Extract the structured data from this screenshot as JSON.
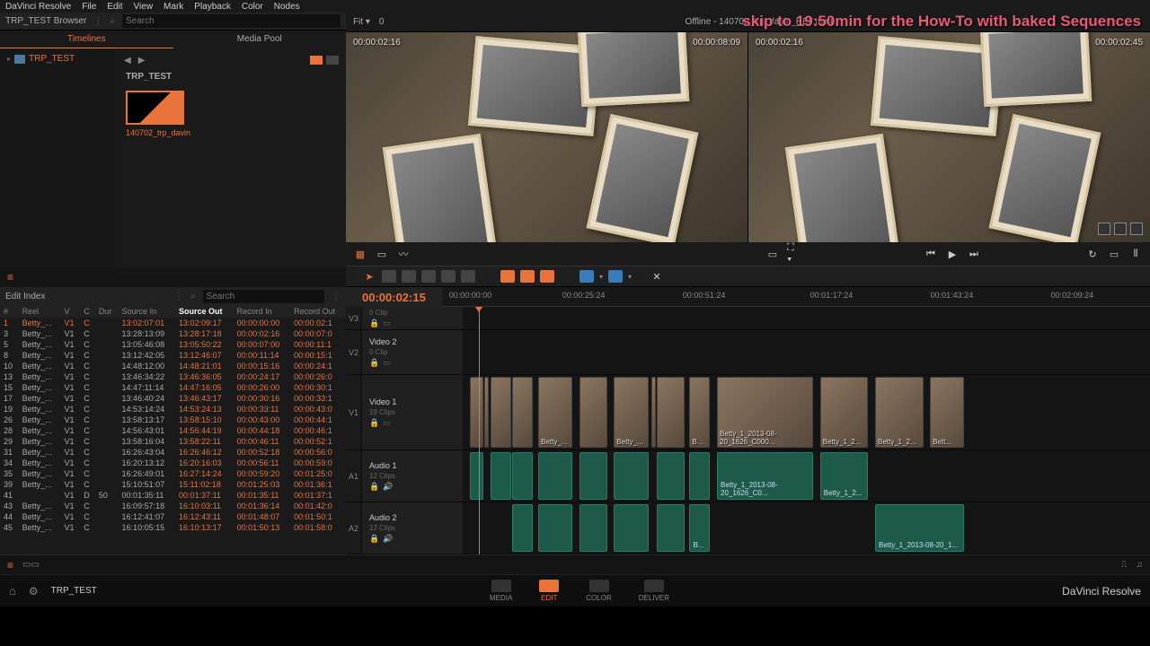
{
  "overlay_text": "skip to 19:50min for the How-To with baked Sequences",
  "menubar": [
    "DaVinci Resolve",
    "File",
    "Edit",
    "View",
    "Mark",
    "Playback",
    "Color",
    "Nodes"
  ],
  "browser": {
    "title": "TRP_TEST Browser",
    "search_ph": "Search",
    "tabs": {
      "timelines": "Timelines",
      "mediapool": "Media Pool"
    },
    "tree_item": "TRP_TEST",
    "bin_title": "TRP_TEST",
    "thumb_label": "140702_trp_davin"
  },
  "viewer": {
    "fit": "Fit",
    "zoom": "0",
    "title": "Offline - 140702_trp_davin_REF.mp4",
    "tc_left_src": "00:00:02:16",
    "tc_right_src": "00:00:08:09",
    "tc_left_rec": "00:00:02:16",
    "tc_right_rec": "00:00:02:45"
  },
  "toolbar_labels": {
    "arrow": "select",
    "razor": "blade"
  },
  "editindex": {
    "title": "Edit Index",
    "search_ph": "Search",
    "cols": [
      "#",
      "Reel",
      "V",
      "C",
      "Dur",
      "Source In",
      "Source Out",
      "Record In",
      "Record Out"
    ],
    "rows": [
      {
        "n": "1",
        "reel": "Betty_...",
        "v": "V1",
        "c": "C",
        "dur": "",
        "si": "13:02:07:01",
        "so": "13:02:09:17",
        "ri": "00:00:00:00",
        "ro": "00:00:02:1",
        "sel": true
      },
      {
        "n": "3",
        "reel": "Betty_...",
        "v": "V1",
        "c": "C",
        "dur": "",
        "si": "13:28:13:09",
        "so": "13:28:17:18",
        "ri": "00:00:02:16",
        "ro": "00:00:07:0"
      },
      {
        "n": "5",
        "reel": "Betty_...",
        "v": "V1",
        "c": "C",
        "dur": "",
        "si": "13:05:46:08",
        "so": "13:05:50:22",
        "ri": "00:00:07:00",
        "ro": "00:00:11:1"
      },
      {
        "n": "8",
        "reel": "Betty_...",
        "v": "V1",
        "c": "C",
        "dur": "",
        "si": "13:12:42:05",
        "so": "13:12:46:07",
        "ri": "00:00:11:14",
        "ro": "00:00:15:1"
      },
      {
        "n": "10",
        "reel": "Betty_...",
        "v": "V1",
        "c": "C",
        "dur": "",
        "si": "14:48:12:00",
        "so": "14:48:21:01",
        "ri": "00:00:15:16",
        "ro": "00:00:24:1"
      },
      {
        "n": "13",
        "reel": "Betty_...",
        "v": "V1",
        "c": "C",
        "dur": "",
        "si": "13:46:34:22",
        "so": "13:46:36:05",
        "ri": "00:00:24:17",
        "ro": "00:00:26:0"
      },
      {
        "n": "15",
        "reel": "Betty_...",
        "v": "V1",
        "c": "C",
        "dur": "",
        "si": "14:47:11:14",
        "so": "14:47:16:05",
        "ri": "00:00:26:00",
        "ro": "00:00:30:1"
      },
      {
        "n": "17",
        "reel": "Betty_...",
        "v": "V1",
        "c": "C",
        "dur": "",
        "si": "13:46:40:24",
        "so": "13:46:43:17",
        "ri": "00:00:30:16",
        "ro": "00:00:33:1"
      },
      {
        "n": "19",
        "reel": "Betty_...",
        "v": "V1",
        "c": "C",
        "dur": "",
        "si": "14:53:14:24",
        "so": "14:53:24:13",
        "ri": "00:00:33:11",
        "ro": "00:00:43:0"
      },
      {
        "n": "26",
        "reel": "Betty_...",
        "v": "V1",
        "c": "C",
        "dur": "",
        "si": "13:58:13:17",
        "so": "13:58:15:10",
        "ri": "00:00:43:00",
        "ro": "00:00:44:1"
      },
      {
        "n": "28",
        "reel": "Betty_...",
        "v": "V1",
        "c": "C",
        "dur": "",
        "si": "14:56:43:01",
        "so": "14:56:44:19",
        "ri": "00:00:44:18",
        "ro": "00:00:46:1"
      },
      {
        "n": "29",
        "reel": "Betty_...",
        "v": "V1",
        "c": "C",
        "dur": "",
        "si": "13:58:16:04",
        "so": "13:58:22:11",
        "ri": "00:00:46:11",
        "ro": "00:00:52:1"
      },
      {
        "n": "31",
        "reel": "Betty_...",
        "v": "V1",
        "c": "C",
        "dur": "",
        "si": "16:26:43:04",
        "so": "16:26:46:12",
        "ri": "00:00:52:18",
        "ro": "00:00:56:0"
      },
      {
        "n": "34",
        "reel": "Betty_...",
        "v": "V1",
        "c": "C",
        "dur": "",
        "si": "16:20:13:12",
        "so": "16:20:16:03",
        "ri": "00:00:56:11",
        "ro": "00:00:59:0"
      },
      {
        "n": "35",
        "reel": "Betty_...",
        "v": "V1",
        "c": "C",
        "dur": "",
        "si": "16:26:49:01",
        "so": "16:27:14:24",
        "ri": "00:00:59:20",
        "ro": "00:01:25:0"
      },
      {
        "n": "39",
        "reel": "Betty_...",
        "v": "V1",
        "c": "C",
        "dur": "",
        "si": "15:10:51:07",
        "so": "15:11:02:18",
        "ri": "00:01:25:03",
        "ro": "00:01:36:1"
      },
      {
        "n": "41",
        "reel": "",
        "v": "V1",
        "c": "D",
        "dur": "50",
        "si": "00:01:35:11",
        "so": "00:01:37:11",
        "ri": "00:01:35:11",
        "ro": "00:01:37:1"
      },
      {
        "n": "43",
        "reel": "Betty_...",
        "v": "V1",
        "c": "C",
        "dur": "",
        "si": "16:09:57:18",
        "so": "16:10:03:11",
        "ri": "00:01:36:14",
        "ro": "00:01:42:0"
      },
      {
        "n": "44",
        "reel": "Betty_...",
        "v": "V1",
        "c": "C",
        "dur": "",
        "si": "16:12:41:07",
        "so": "16:12:43:11",
        "ri": "00:01:48:07",
        "ro": "00:01:50:1"
      },
      {
        "n": "45",
        "reel": "Betty_...",
        "v": "V1",
        "c": "C",
        "dur": "",
        "si": "16:10:05:15",
        "so": "16:10:13:17",
        "ri": "00:01:50:13",
        "ro": "00:01:58:0"
      }
    ]
  },
  "timeline": {
    "tc": "00:00:02:15",
    "ruler": [
      {
        "t": "00:00:00:00",
        "p": 1
      },
      {
        "t": "00:00:25:24",
        "p": 17
      },
      {
        "t": "00:00:51:24",
        "p": 34
      },
      {
        "t": "00:01:17:24",
        "p": 52
      },
      {
        "t": "00:01:43:24",
        "p": 69
      },
      {
        "t": "00:02:09:24",
        "p": 86
      }
    ],
    "playhead_pct": 2,
    "tracks": {
      "v3": {
        "lbl": "V3",
        "sub": "0 Clip"
      },
      "v2": {
        "name": "Video 2",
        "lbl": "V2",
        "sub": "0 Clip"
      },
      "v1": {
        "name": "Video 1",
        "lbl": "V1",
        "sub": "19 Clips",
        "clips": [
          {
            "l": 1,
            "w": 2,
            "t": ""
          },
          {
            "l": 3.2,
            "w": 0.6,
            "t": ""
          },
          {
            "l": 4,
            "w": 3,
            "t": ""
          },
          {
            "l": 7.2,
            "w": 3,
            "t": ""
          },
          {
            "l": 11,
            "w": 5,
            "t": "Betty_..."
          },
          {
            "l": 17,
            "w": 4,
            "t": ""
          },
          {
            "l": 22,
            "w": 5,
            "t": "Betty_..."
          },
          {
            "l": 27.5,
            "w": 0.6,
            "t": ""
          },
          {
            "l": 28.3,
            "w": 4,
            "t": ""
          },
          {
            "l": 33,
            "w": 3,
            "t": "B..."
          },
          {
            "l": 37,
            "w": 14,
            "t": "Betty_1_2013-08-20_1626_C000..."
          },
          {
            "l": 52,
            "w": 7,
            "t": "Betty_1_2..."
          },
          {
            "l": 60,
            "w": 7,
            "t": "Betty_1_2..."
          },
          {
            "l": 68,
            "w": 5,
            "t": "Bett..."
          }
        ]
      },
      "a1": {
        "name": "Audio 1",
        "lbl": "A1",
        "sub": "12 Clips",
        "clips": [
          {
            "l": 1,
            "w": 2,
            "t": ""
          },
          {
            "l": 4,
            "w": 3,
            "t": ""
          },
          {
            "l": 7.2,
            "w": 3,
            "t": ""
          },
          {
            "l": 11,
            "w": 5,
            "t": ""
          },
          {
            "l": 17,
            "w": 4,
            "t": ""
          },
          {
            "l": 22,
            "w": 5,
            "t": ""
          },
          {
            "l": 28.3,
            "w": 4,
            "t": ""
          },
          {
            "l": 33,
            "w": 3,
            "t": ""
          },
          {
            "l": 37,
            "w": 14,
            "t": "Betty_1_2013-08-20_1626_C0..."
          },
          {
            "l": 52,
            "w": 7,
            "t": "Betty_1_2..."
          }
        ]
      },
      "a2": {
        "name": "Audio 2",
        "lbl": "A2",
        "sub": "12 Clips",
        "clips": [
          {
            "l": 7.2,
            "w": 3,
            "t": ""
          },
          {
            "l": 11,
            "w": 5,
            "t": ""
          },
          {
            "l": 17,
            "w": 4,
            "t": ""
          },
          {
            "l": 22,
            "w": 5,
            "t": ""
          },
          {
            "l": 28.3,
            "w": 4,
            "t": ""
          },
          {
            "l": 33,
            "w": 3,
            "t": "B..."
          },
          {
            "l": 60,
            "w": 13,
            "t": "Betty_1_2013-08-20_1..."
          }
        ]
      }
    }
  },
  "pages": {
    "media": "MEDIA",
    "edit": "EDIT",
    "color": "COLOR",
    "deliver": "DELIVER"
  },
  "footer": {
    "project": "TRP_TEST",
    "brand": "DaVinci Resolve"
  }
}
